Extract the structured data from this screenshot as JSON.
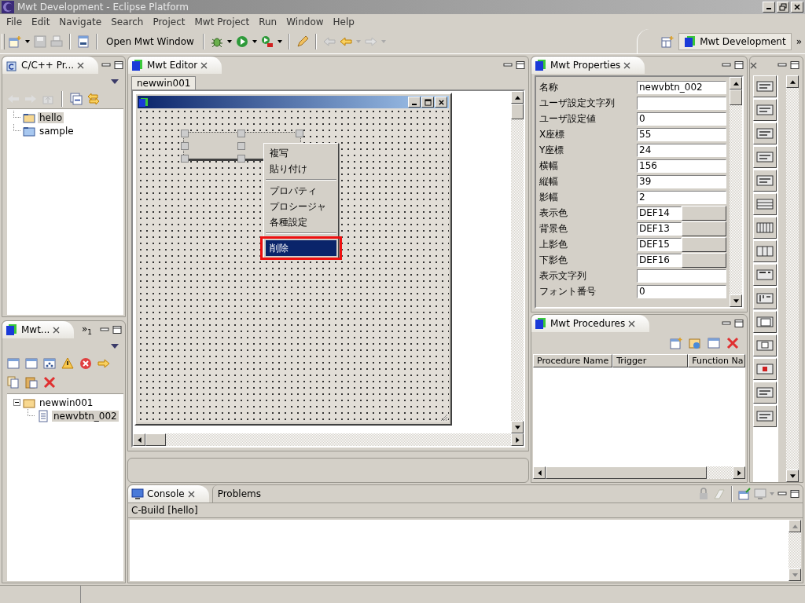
{
  "window": {
    "title": "Mwt Development - Eclipse Platform"
  },
  "menu": [
    {
      "label": "File"
    },
    {
      "label": "Edit"
    },
    {
      "label": "Navigate"
    },
    {
      "label": "Search"
    },
    {
      "label": "Project"
    },
    {
      "label": "Mwt Project"
    },
    {
      "label": "Run"
    },
    {
      "label": "Window"
    },
    {
      "label": "Help"
    }
  ],
  "toolbar": {
    "open_button": "Open Mwt Window"
  },
  "perspective": {
    "label": "Mwt Development",
    "more": "»"
  },
  "project_view": {
    "tab": "C/C++ Pr...",
    "tree": [
      {
        "label": "hello",
        "selected": true
      },
      {
        "label": "sample",
        "selected": false
      }
    ]
  },
  "outline_view": {
    "tab": "Mwt...",
    "overflow": "»",
    "overflow_count": "1",
    "tree": [
      {
        "label": "newwin001",
        "expanded": true,
        "selected": false,
        "children": [
          {
            "label": "newvbtn_002",
            "selected": true
          }
        ]
      }
    ]
  },
  "editor": {
    "tab": "Mwt Editor",
    "doc_tab": "newwin001",
    "context_menu": [
      {
        "kind": "item",
        "label": "複写",
        "selected": false
      },
      {
        "kind": "item",
        "label": "貼り付け",
        "selected": false
      },
      {
        "kind": "separator"
      },
      {
        "kind": "item",
        "label": "プロパティ",
        "selected": false
      },
      {
        "kind": "item",
        "label": "プロシージャ",
        "selected": false
      },
      {
        "kind": "item",
        "label": "各種設定",
        "selected": false
      },
      {
        "kind": "separator"
      },
      {
        "kind": "item",
        "label": "削除",
        "selected": true
      }
    ]
  },
  "properties": {
    "tab": "Mwt Properties",
    "rows": [
      {
        "kind": "text",
        "label": "名称",
        "value": "newvbtn_002"
      },
      {
        "kind": "text",
        "label": "ユーザ設定文字列",
        "value": ""
      },
      {
        "kind": "text",
        "label": "ユーザ設定値",
        "value": "0"
      },
      {
        "kind": "text",
        "label": "X座標",
        "value": "55"
      },
      {
        "kind": "text",
        "label": "Y座標",
        "value": "24"
      },
      {
        "kind": "text",
        "label": "横幅",
        "value": "156"
      },
      {
        "kind": "text",
        "label": "縦幅",
        "value": "39"
      },
      {
        "kind": "text",
        "label": "影幅",
        "value": "2"
      },
      {
        "kind": "color",
        "label": "表示色",
        "value": "DEF14"
      },
      {
        "kind": "color",
        "label": "背景色",
        "value": "DEF13"
      },
      {
        "kind": "color",
        "label": "上影色",
        "value": "DEF15"
      },
      {
        "kind": "color",
        "label": "下影色",
        "value": "DEF16"
      },
      {
        "kind": "text",
        "label": "表示文字列",
        "value": ""
      },
      {
        "kind": "text",
        "label": "フォント番号",
        "value": "0"
      }
    ]
  },
  "procedures": {
    "tab": "Mwt Procedures",
    "columns": [
      "Procedure Name",
      "Trigger",
      "Function Na"
    ]
  },
  "console": {
    "tabs": [
      {
        "label": "Console",
        "selected": true
      },
      {
        "label": "Problems",
        "selected": false
      }
    ],
    "subtitle": "C-Build [hello]"
  }
}
